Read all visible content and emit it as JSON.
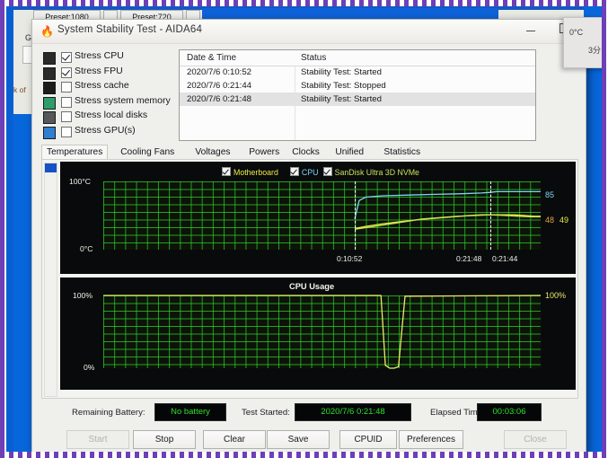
{
  "background_app": {
    "preset_1080": "Preset:1080",
    "preset_720": "Preset:720",
    "gpu_label": "GPU",
    "partial_text": "k of"
  },
  "note_overlay": {
    "temp": "0°C",
    "minutes": "3分"
  },
  "window": {
    "title": "System Stability Test - AIDA64",
    "icon": "flame-icon",
    "minimize_label": "",
    "maximize_label": ""
  },
  "stress_options": [
    {
      "label": "Stress CPU",
      "checked": true,
      "icon": "cpu-icon"
    },
    {
      "label": "Stress FPU",
      "checked": true,
      "icon": "fpu-icon"
    },
    {
      "label": "Stress cache",
      "checked": false,
      "icon": "cache-icon"
    },
    {
      "label": "Stress system memory",
      "checked": false,
      "icon": "memory-icon"
    },
    {
      "label": "Stress local disks",
      "checked": false,
      "icon": "disk-icon"
    },
    {
      "label": "Stress GPU(s)",
      "checked": false,
      "icon": "gpu-icon"
    }
  ],
  "log": {
    "columns": [
      "Date & Time",
      "Status"
    ],
    "rows": [
      {
        "datetime": "2020/7/6 0:10:52",
        "status": "Stability Test: Started",
        "selected": false
      },
      {
        "datetime": "2020/7/6 0:21:44",
        "status": "Stability Test: Stopped",
        "selected": false
      },
      {
        "datetime": "2020/7/6 0:21:48",
        "status": "Stability Test: Started",
        "selected": true
      }
    ]
  },
  "tabs": [
    {
      "label": "Temperatures",
      "active": true
    },
    {
      "label": "Cooling Fans",
      "active": false
    },
    {
      "label": "Voltages",
      "active": false
    },
    {
      "label": "Powers",
      "active": false
    },
    {
      "label": "Clocks",
      "active": false
    },
    {
      "label": "Unified",
      "active": false
    },
    {
      "label": "Statistics",
      "active": false
    }
  ],
  "status_fields": [
    {
      "label": "Remaining Battery:",
      "value": "No battery",
      "color": "#2ee22e"
    },
    {
      "label": "Test Started:",
      "value": "2020/7/6 0:21:48",
      "color": "#2ee22e"
    },
    {
      "label": "Elapsed Time:",
      "value": "00:03:06",
      "color": "#2ee22e"
    }
  ],
  "buttons": [
    {
      "label": "Start",
      "disabled": true
    },
    {
      "label": "Stop",
      "disabled": false
    },
    {
      "label": "Clear",
      "disabled": false
    },
    {
      "label": "Save",
      "disabled": false
    },
    {
      "label": "CPUID",
      "disabled": false
    },
    {
      "label": "Preferences",
      "disabled": false
    },
    {
      "label": "Close",
      "disabled": true
    }
  ],
  "chart_data": [
    {
      "type": "line",
      "name": "temperatures",
      "title": "",
      "xlabel": "",
      "ylabel": "",
      "ylim": [
        0,
        100
      ],
      "ytick_labels": [
        "100°C",
        "0°C"
      ],
      "grid": true,
      "legend_position": "top-center",
      "markers": [
        {
          "label": "0:10:52",
          "x_frac": 0.575
        },
        {
          "label": "0:21:48",
          "x_frac": 0.885
        },
        {
          "label": "0:21:44",
          "x_frac": 0.885
        }
      ],
      "series": [
        {
          "name": "Motherboard",
          "color": "#ecea4a",
          "checked": true,
          "end_label": "49",
          "x": [
            0.575,
            0.6,
            0.64,
            0.68,
            0.72,
            0.76,
            0.8,
            0.835,
            0.865,
            0.885,
            0.91,
            0.94,
            0.965,
            0.985,
            1.0
          ],
          "values": [
            31,
            34,
            38,
            41,
            44,
            46,
            48,
            50,
            51,
            51,
            51,
            51,
            50,
            49,
            49
          ]
        },
        {
          "name": "CPU",
          "color": "#7fd4f2",
          "checked": true,
          "end_label": "85",
          "x": [
            0.575,
            0.585,
            0.6,
            0.64,
            0.7,
            0.76,
            0.82,
            0.865,
            0.885,
            0.9,
            0.94,
            0.97,
            1.0
          ],
          "values": [
            45,
            72,
            77,
            79,
            80,
            81,
            82,
            83,
            84,
            85,
            85,
            85,
            85
          ]
        },
        {
          "name": "SanDisk Ultra 3D NVMe",
          "color": "#c9e05a",
          "checked": true,
          "end_label": "48",
          "x": [
            0.575,
            0.61,
            0.65,
            0.69,
            0.73,
            0.77,
            0.81,
            0.85,
            0.885,
            0.92,
            0.95,
            0.98,
            1.0
          ],
          "values": [
            30,
            33,
            37,
            41,
            45,
            47,
            49,
            50,
            51,
            50,
            49,
            48,
            48
          ]
        }
      ]
    },
    {
      "type": "line",
      "name": "cpu_usage",
      "title": "CPU Usage",
      "xlabel": "",
      "ylabel": "",
      "ylim": [
        0,
        100
      ],
      "ytick_labels": [
        "100%",
        "0%"
      ],
      "right_label": "100%",
      "grid": true,
      "series": [
        {
          "name": "CPU Usage",
          "color": "#eceb6a",
          "x": [
            0.0,
            0.62,
            0.635,
            0.645,
            0.655,
            0.665,
            0.675,
            0.69,
            1.0
          ],
          "values": [
            100,
            100,
            100,
            4,
            0,
            0,
            2,
            99,
            100
          ]
        }
      ]
    }
  ]
}
